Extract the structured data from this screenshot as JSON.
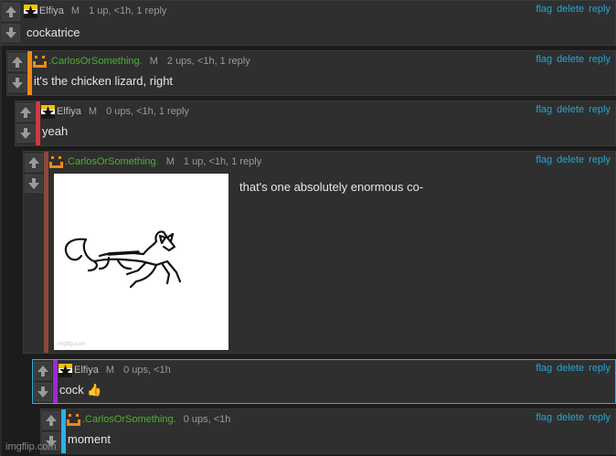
{
  "colors": {
    "link": "#22a6d8",
    "carlos": "#4caf33",
    "bar_orange": "#ef8a12",
    "bar_red": "#d13a3a",
    "bar_brown": "#8a4a3a",
    "bar_purple": "#9b2bd6",
    "bar_cyan": "#2fb0e6",
    "selected_border": "#2fb0d6"
  },
  "actions": {
    "flag": "flag",
    "delete": "delete",
    "reply": "reply"
  },
  "mod_badge": "M",
  "comments": [
    {
      "user": "Elfiya",
      "meta": "1 up, <1h, 1 reply",
      "text": "cockatrice",
      "avatar": "star-flag-icon"
    },
    {
      "user": ".CarlosOrSomething.",
      "meta": "2 ups, <1h, 1 reply",
      "text": "it's the chicken lizard, right",
      "avatar": "orange-smiley-icon"
    },
    {
      "user": "Elfiya",
      "meta": "0 ups, <1h, 1 reply",
      "text": "yeah",
      "avatar": "star-flag-icon"
    },
    {
      "user": ".CarlosOrSomething.",
      "meta": "1 up, <1h, 1 reply",
      "text": "that's one absolutely enormous co-",
      "avatar": "orange-smiley-icon",
      "image": "chicken-lizard-drawing"
    },
    {
      "user": "Elfiya",
      "meta": "0 ups, <1h",
      "text": "cock 👍",
      "avatar": "star-flag-icon"
    },
    {
      "user": ".CarlosOrSomething.",
      "meta": "0 ups, <1h",
      "text": "moment",
      "avatar": "orange-smiley-icon"
    }
  ],
  "image_caption": "imgflip.com",
  "watermark": "imgflip.com"
}
